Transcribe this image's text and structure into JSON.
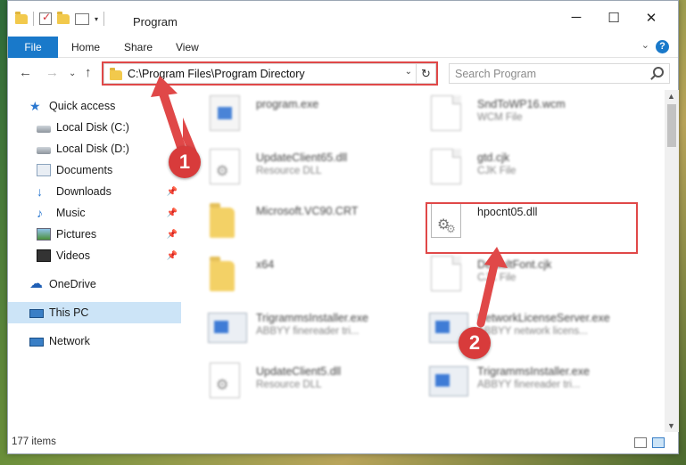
{
  "window": {
    "title": "Program"
  },
  "ribbon": {
    "file": "File",
    "home": "Home",
    "share": "Share",
    "view": "View",
    "help": "?"
  },
  "address": {
    "path": "C:\\Program Files\\Program Directory",
    "refresh": "↻",
    "dropdown": "⌄"
  },
  "search": {
    "placeholder": "Search Program"
  },
  "controls": {
    "minimize": "─",
    "maximize": "☐",
    "close": "✕"
  },
  "sidebar": {
    "items": [
      {
        "label": "Quick access"
      },
      {
        "label": "Local Disk (C:)"
      },
      {
        "label": "Local Disk (D:)"
      },
      {
        "label": "Documents"
      },
      {
        "label": "Downloads"
      },
      {
        "label": "Music"
      },
      {
        "label": "Pictures"
      },
      {
        "label": "Videos"
      },
      {
        "label": "OneDrive"
      },
      {
        "label": "This PC"
      },
      {
        "label": "Network"
      }
    ]
  },
  "files": [
    {
      "name": "program.exe",
      "type": ""
    },
    {
      "name": "SndToWP16.wcm",
      "type": "WCM File"
    },
    {
      "name": "UpdateClient65.dll",
      "type": "Resource DLL"
    },
    {
      "name": "gtd.cjk",
      "type": "CJK File"
    },
    {
      "name": "Microsoft.VC90.CRT",
      "type": ""
    },
    {
      "name": "hpocnt05.dll",
      "type": ""
    },
    {
      "name": "x64",
      "type": ""
    },
    {
      "name": "DefaultFont.cjk",
      "type": "CJK File"
    },
    {
      "name": "TrigrammsInstaller.exe",
      "type": "ABBYY finereader tri..."
    },
    {
      "name": "NetworkLicenseServer.exe",
      "type": "ABBYY network licens..."
    },
    {
      "name": "UpdateClient5.dll",
      "type": "Resource DLL"
    },
    {
      "name": "TrigrammsInstaller.exe",
      "type": "ABBYY finereader tri..."
    }
  ],
  "callouts": {
    "one": "1",
    "two": "2"
  },
  "status": {
    "count": "177 items"
  },
  "colors": {
    "accent": "#1979ca",
    "highlight": "#e04848",
    "callout": "#d83b3b",
    "selected": "#cce4f7"
  }
}
